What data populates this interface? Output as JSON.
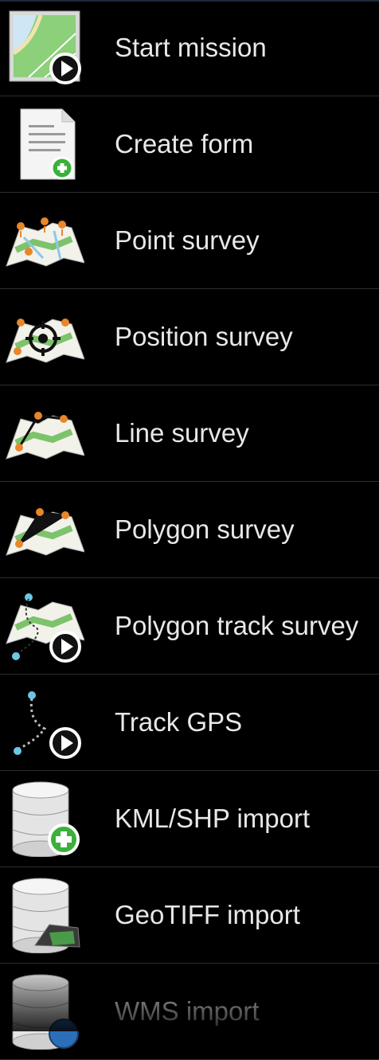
{
  "menu": {
    "items": [
      {
        "label": "Start mission",
        "icon": "map-play-icon"
      },
      {
        "label": "Create form",
        "icon": "form-add-icon"
      },
      {
        "label": "Point survey",
        "icon": "map-points-icon"
      },
      {
        "label": "Position survey",
        "icon": "map-target-icon"
      },
      {
        "label": "Line survey",
        "icon": "map-line-icon"
      },
      {
        "label": "Polygon survey",
        "icon": "map-polygon-icon"
      },
      {
        "label": "Polygon track survey",
        "icon": "map-track-play-icon"
      },
      {
        "label": "Track GPS",
        "icon": "track-play-icon"
      },
      {
        "label": "KML/SHP import",
        "icon": "database-add-icon"
      },
      {
        "label": "GeoTIFF import",
        "icon": "database-image-icon"
      },
      {
        "label": "WMS import",
        "icon": "database-globe-icon"
      }
    ]
  },
  "colors": {
    "background": "#000000",
    "text": "#e8e8e8",
    "divider": "#2e2e2e",
    "map_green": "#7cc36b",
    "map_paper": "#f2f2ea",
    "pin_orange": "#e8862a"
  }
}
